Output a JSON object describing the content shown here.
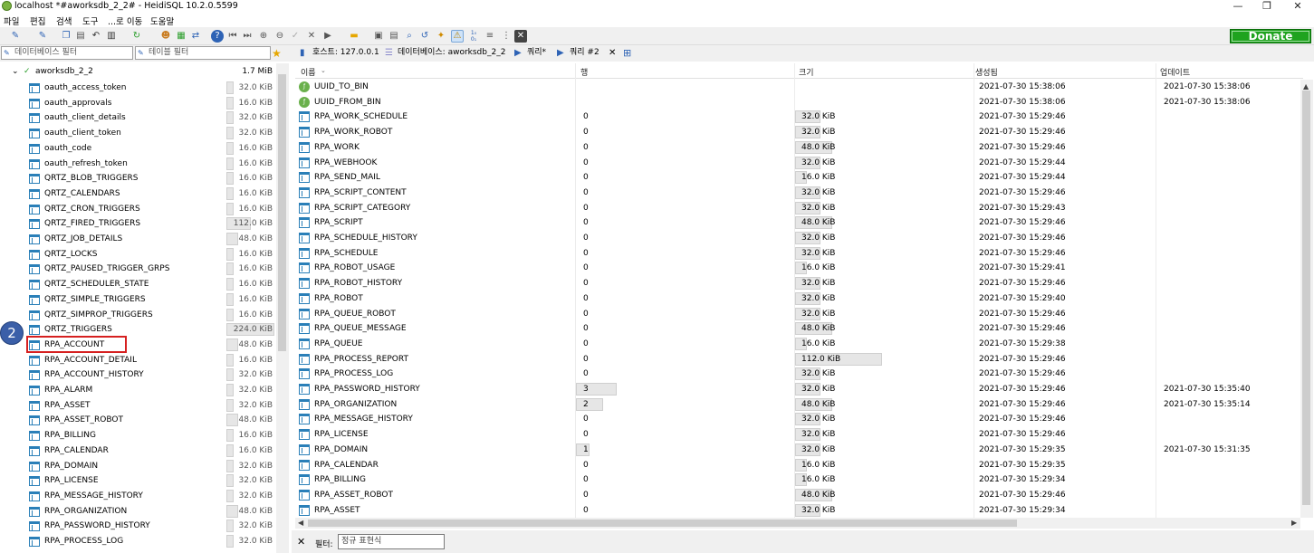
{
  "window": {
    "title": "localhost *#aworksdb_2_2# - HeidiSQL 10.2.0.5599"
  },
  "menu": [
    "파일",
    "편집",
    "검색",
    "도구",
    "...로 이동",
    "도움말"
  ],
  "donate_label": "Donate",
  "filters": {
    "database_placeholder": "데이터베이스 필터",
    "table_placeholder": "테이블 필터"
  },
  "tabs": [
    {
      "label": "호스트: 127.0.0.1",
      "icon": "host-icon"
    },
    {
      "label": "데이터베이스: aworksdb_2_2",
      "icon": "database-icon"
    },
    {
      "label": "쿼리*",
      "icon": "play-icon"
    },
    {
      "label": "쿼리 #2",
      "icon": "play-icon"
    }
  ],
  "tree": {
    "db": {
      "name": "aworksdb_2_2",
      "size": "1.7 MiB"
    },
    "tables": [
      {
        "name": "oauth_access_token",
        "size": "32.0 KiB",
        "bar": 0.06
      },
      {
        "name": "oauth_approvals",
        "size": "16.0 KiB",
        "bar": 0.03
      },
      {
        "name": "oauth_client_details",
        "size": "32.0 KiB",
        "bar": 0.06
      },
      {
        "name": "oauth_client_token",
        "size": "32.0 KiB",
        "bar": 0.06
      },
      {
        "name": "oauth_code",
        "size": "16.0 KiB",
        "bar": 0.03
      },
      {
        "name": "oauth_refresh_token",
        "size": "16.0 KiB",
        "bar": 0.03
      },
      {
        "name": "QRTZ_BLOB_TRIGGERS",
        "size": "16.0 KiB",
        "bar": 0.03
      },
      {
        "name": "QRTZ_CALENDARS",
        "size": "16.0 KiB",
        "bar": 0.03
      },
      {
        "name": "QRTZ_CRON_TRIGGERS",
        "size": "16.0 KiB",
        "bar": 0.03
      },
      {
        "name": "QRTZ_FIRED_TRIGGERS",
        "size": "112.0 KiB",
        "bar": 0.19
      },
      {
        "name": "QRTZ_JOB_DETAILS",
        "size": "48.0 KiB",
        "bar": 0.09
      },
      {
        "name": "QRTZ_LOCKS",
        "size": "16.0 KiB",
        "bar": 0.03
      },
      {
        "name": "QRTZ_PAUSED_TRIGGER_GRPS",
        "size": "16.0 KiB",
        "bar": 0.03
      },
      {
        "name": "QRTZ_SCHEDULER_STATE",
        "size": "16.0 KiB",
        "bar": 0.03
      },
      {
        "name": "QRTZ_SIMPLE_TRIGGERS",
        "size": "16.0 KiB",
        "bar": 0.03
      },
      {
        "name": "QRTZ_SIMPROP_TRIGGERS",
        "size": "16.0 KiB",
        "bar": 0.03
      },
      {
        "name": "QRTZ_TRIGGERS",
        "size": "224.0 KiB",
        "bar": 0.38
      },
      {
        "name": "RPA_ACCOUNT",
        "size": "48.0 KiB",
        "bar": 0.09
      },
      {
        "name": "RPA_ACCOUNT_DETAIL",
        "size": "16.0 KiB",
        "bar": 0.03
      },
      {
        "name": "RPA_ACCOUNT_HISTORY",
        "size": "32.0 KiB",
        "bar": 0.06
      },
      {
        "name": "RPA_ALARM",
        "size": "32.0 KiB",
        "bar": 0.06
      },
      {
        "name": "RPA_ASSET",
        "size": "32.0 KiB",
        "bar": 0.06
      },
      {
        "name": "RPA_ASSET_ROBOT",
        "size": "48.0 KiB",
        "bar": 0.09
      },
      {
        "name": "RPA_BILLING",
        "size": "16.0 KiB",
        "bar": 0.03
      },
      {
        "name": "RPA_CALENDAR",
        "size": "16.0 KiB",
        "bar": 0.03
      },
      {
        "name": "RPA_DOMAIN",
        "size": "32.0 KiB",
        "bar": 0.06
      },
      {
        "name": "RPA_LICENSE",
        "size": "32.0 KiB",
        "bar": 0.06
      },
      {
        "name": "RPA_MESSAGE_HISTORY",
        "size": "32.0 KiB",
        "bar": 0.06
      },
      {
        "name": "RPA_ORGANIZATION",
        "size": "48.0 KiB",
        "bar": 0.09
      },
      {
        "name": "RPA_PASSWORD_HISTORY",
        "size": "32.0 KiB",
        "bar": 0.06
      },
      {
        "name": "RPA_PROCESS_LOG",
        "size": "32.0 KiB",
        "bar": 0.06
      }
    ]
  },
  "marker_label": "2",
  "grid": {
    "headers": [
      "이름",
      "행",
      "크기",
      "생성됨",
      "업데이트"
    ],
    "rows": [
      {
        "name": "UUID_TO_BIN",
        "type": "function",
        "rows": "",
        "rowbar": 0,
        "size": "",
        "sizebar": 0,
        "created": "2021-07-30 15:38:06",
        "updated": "2021-07-30 15:38:06"
      },
      {
        "name": "UUID_FROM_BIN",
        "type": "function",
        "rows": "",
        "rowbar": 0,
        "size": "",
        "sizebar": 0,
        "created": "2021-07-30 15:38:06",
        "updated": "2021-07-30 15:38:06"
      },
      {
        "name": "RPA_WORK_SCHEDULE",
        "type": "table",
        "rows": "0",
        "rowbar": 0,
        "size": "32.0 KiB",
        "sizebar": 0.29,
        "created": "2021-07-30 15:29:46",
        "updated": ""
      },
      {
        "name": "RPA_WORK_ROBOT",
        "type": "table",
        "rows": "0",
        "rowbar": 0,
        "size": "32.0 KiB",
        "sizebar": 0.29,
        "created": "2021-07-30 15:29:46",
        "updated": ""
      },
      {
        "name": "RPA_WORK",
        "type": "table",
        "rows": "0",
        "rowbar": 0,
        "size": "48.0 KiB",
        "sizebar": 0.43,
        "created": "2021-07-30 15:29:46",
        "updated": ""
      },
      {
        "name": "RPA_WEBHOOK",
        "type": "table",
        "rows": "0",
        "rowbar": 0,
        "size": "32.0 KiB",
        "sizebar": 0.29,
        "created": "2021-07-30 15:29:44",
        "updated": ""
      },
      {
        "name": "RPA_SEND_MAIL",
        "type": "table",
        "rows": "0",
        "rowbar": 0,
        "size": "16.0 KiB",
        "sizebar": 0.14,
        "created": "2021-07-30 15:29:44",
        "updated": ""
      },
      {
        "name": "RPA_SCRIPT_CONTENT",
        "type": "table",
        "rows": "0",
        "rowbar": 0,
        "size": "32.0 KiB",
        "sizebar": 0.29,
        "created": "2021-07-30 15:29:46",
        "updated": ""
      },
      {
        "name": "RPA_SCRIPT_CATEGORY",
        "type": "table",
        "rows": "0",
        "rowbar": 0,
        "size": "32.0 KiB",
        "sizebar": 0.29,
        "created": "2021-07-30 15:29:43",
        "updated": ""
      },
      {
        "name": "RPA_SCRIPT",
        "type": "table",
        "rows": "0",
        "rowbar": 0,
        "size": "48.0 KiB",
        "sizebar": 0.43,
        "created": "2021-07-30 15:29:46",
        "updated": ""
      },
      {
        "name": "RPA_SCHEDULE_HISTORY",
        "type": "table",
        "rows": "0",
        "rowbar": 0,
        "size": "32.0 KiB",
        "sizebar": 0.29,
        "created": "2021-07-30 15:29:46",
        "updated": ""
      },
      {
        "name": "RPA_SCHEDULE",
        "type": "table",
        "rows": "0",
        "rowbar": 0,
        "size": "32.0 KiB",
        "sizebar": 0.29,
        "created": "2021-07-30 15:29:46",
        "updated": ""
      },
      {
        "name": "RPA_ROBOT_USAGE",
        "type": "table",
        "rows": "0",
        "rowbar": 0,
        "size": "16.0 KiB",
        "sizebar": 0.14,
        "created": "2021-07-30 15:29:41",
        "updated": ""
      },
      {
        "name": "RPA_ROBOT_HISTORY",
        "type": "table",
        "rows": "0",
        "rowbar": 0,
        "size": "32.0 KiB",
        "sizebar": 0.29,
        "created": "2021-07-30 15:29:46",
        "updated": ""
      },
      {
        "name": "RPA_ROBOT",
        "type": "table",
        "rows": "0",
        "rowbar": 0,
        "size": "32.0 KiB",
        "sizebar": 0.29,
        "created": "2021-07-30 15:29:40",
        "updated": ""
      },
      {
        "name": "RPA_QUEUE_ROBOT",
        "type": "table",
        "rows": "0",
        "rowbar": 0,
        "size": "32.0 KiB",
        "sizebar": 0.29,
        "created": "2021-07-30 15:29:46",
        "updated": ""
      },
      {
        "name": "RPA_QUEUE_MESSAGE",
        "type": "table",
        "rows": "0",
        "rowbar": 0,
        "size": "48.0 KiB",
        "sizebar": 0.43,
        "created": "2021-07-30 15:29:46",
        "updated": ""
      },
      {
        "name": "RPA_QUEUE",
        "type": "table",
        "rows": "0",
        "rowbar": 0,
        "size": "16.0 KiB",
        "sizebar": 0.14,
        "created": "2021-07-30 15:29:38",
        "updated": ""
      },
      {
        "name": "RPA_PROCESS_REPORT",
        "type": "table",
        "rows": "0",
        "rowbar": 0,
        "size": "112.0 KiB",
        "sizebar": 1.0,
        "created": "2021-07-30 15:29:46",
        "updated": ""
      },
      {
        "name": "RPA_PROCESS_LOG",
        "type": "table",
        "rows": "0",
        "rowbar": 0,
        "size": "32.0 KiB",
        "sizebar": 0.29,
        "created": "2021-07-30 15:29:46",
        "updated": ""
      },
      {
        "name": "RPA_PASSWORD_HISTORY",
        "type": "table",
        "rows": "3",
        "rowbar": 1.0,
        "size": "32.0 KiB",
        "sizebar": 0.29,
        "created": "2021-07-30 15:29:46",
        "updated": "2021-07-30 15:35:40"
      },
      {
        "name": "RPA_ORGANIZATION",
        "type": "table",
        "rows": "2",
        "rowbar": 0.67,
        "size": "48.0 KiB",
        "sizebar": 0.43,
        "created": "2021-07-30 15:29:46",
        "updated": "2021-07-30 15:35:14"
      },
      {
        "name": "RPA_MESSAGE_HISTORY",
        "type": "table",
        "rows": "0",
        "rowbar": 0,
        "size": "32.0 KiB",
        "sizebar": 0.29,
        "created": "2021-07-30 15:29:46",
        "updated": ""
      },
      {
        "name": "RPA_LICENSE",
        "type": "table",
        "rows": "0",
        "rowbar": 0,
        "size": "32.0 KiB",
        "sizebar": 0.29,
        "created": "2021-07-30 15:29:46",
        "updated": ""
      },
      {
        "name": "RPA_DOMAIN",
        "type": "table",
        "rows": "1",
        "rowbar": 0.33,
        "size": "32.0 KiB",
        "sizebar": 0.29,
        "created": "2021-07-30 15:29:35",
        "updated": "2021-07-30 15:31:35"
      },
      {
        "name": "RPA_CALENDAR",
        "type": "table",
        "rows": "0",
        "rowbar": 0,
        "size": "16.0 KiB",
        "sizebar": 0.14,
        "created": "2021-07-30 15:29:35",
        "updated": ""
      },
      {
        "name": "RPA_BILLING",
        "type": "table",
        "rows": "0",
        "rowbar": 0,
        "size": "16.0 KiB",
        "sizebar": 0.14,
        "created": "2021-07-30 15:29:34",
        "updated": ""
      },
      {
        "name": "RPA_ASSET_ROBOT",
        "type": "table",
        "rows": "0",
        "rowbar": 0,
        "size": "48.0 KiB",
        "sizebar": 0.43,
        "created": "2021-07-30 15:29:46",
        "updated": ""
      },
      {
        "name": "RPA_ASSET",
        "type": "table",
        "rows": "0",
        "rowbar": 0,
        "size": "32.0 KiB",
        "sizebar": 0.29,
        "created": "2021-07-30 15:29:34",
        "updated": ""
      }
    ]
  },
  "bottom": {
    "filter_label": "필터:",
    "regex_placeholder": "정규 표현식"
  }
}
